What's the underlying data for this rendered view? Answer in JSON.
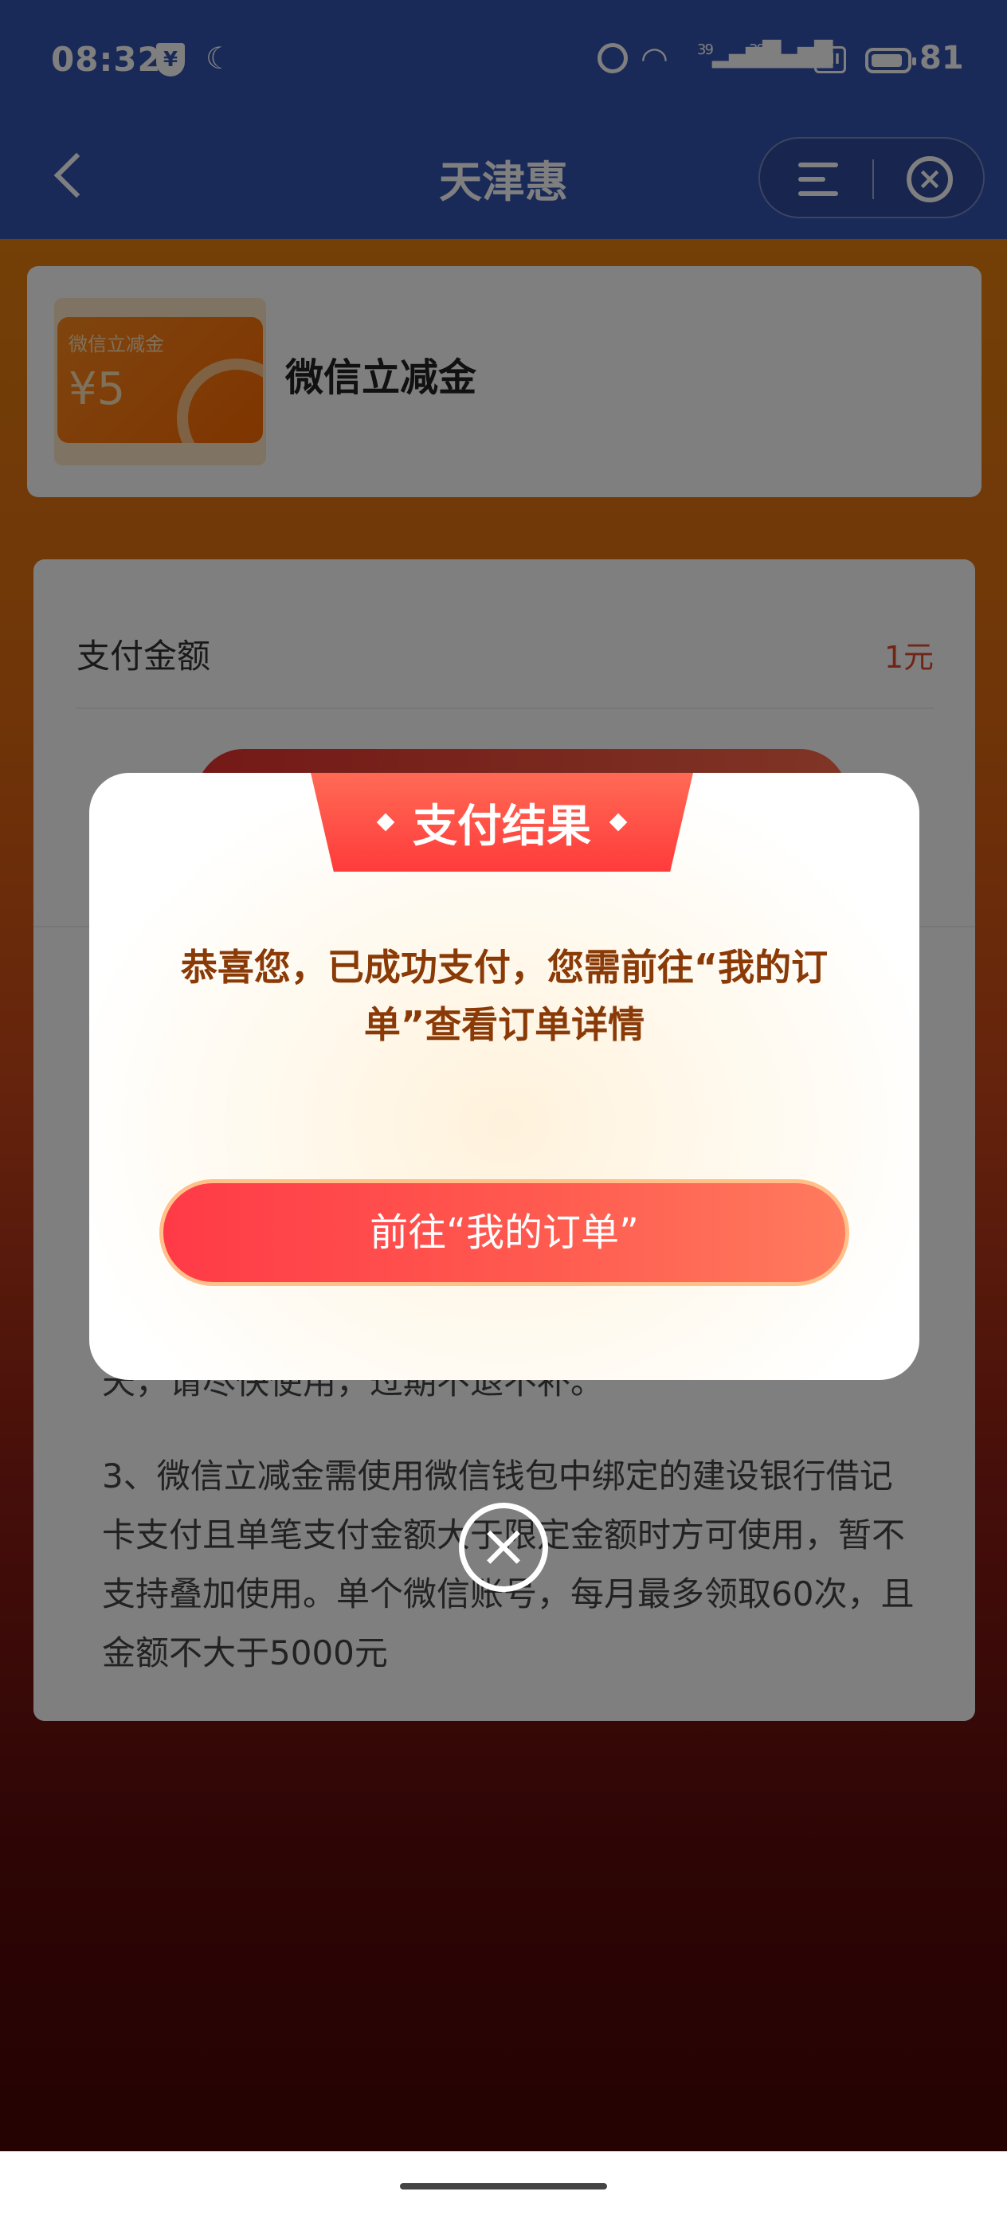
{
  "status_bar": {
    "time": "08:32",
    "shield_symbol": "¥",
    "signal_1": "39",
    "signal_2": "39",
    "miui_label": "MI",
    "battery": "81"
  },
  "header": {
    "title": "天津惠"
  },
  "product": {
    "coupon_label": "微信立减金",
    "coupon_amount": "¥5",
    "name": "微信立减金"
  },
  "detail": {
    "pay_label": "支付金额",
    "pay_value": "1元",
    "rule_fragment": "天，请尽快使用，过期不退不补。",
    "rule_3": "3、微信立减金需使用微信钱包中绑定的建设银行借记卡支付且单笔支付金额大于限定金额时方可使用，暂不支持叠加使用。单个微信账号，每月最多领取60次，且金额不大于5000元"
  },
  "modal": {
    "title": "支付结果",
    "message": "恭喜您，已成功支付，您需前往“我的订单”查看订单详情",
    "button_label": "前往“我的订单”",
    "close_symbol": "×"
  },
  "colors": {
    "header_bg": "#3554b1",
    "accent_red": "#ff3b3b",
    "message_text": "#8a3a06"
  },
  "icons": [
    "shield-icon",
    "moon-icon",
    "clock-icon",
    "wifi-icon",
    "signal-icon",
    "battery-icon",
    "back-arrow-icon",
    "menu-icon",
    "close-circle-icon"
  ]
}
